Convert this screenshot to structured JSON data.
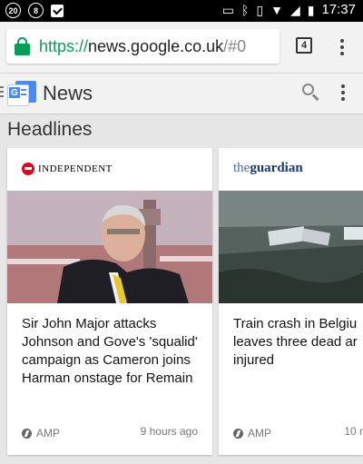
{
  "status_bar": {
    "left_icons": [
      "notification-20-icon",
      "notification-8-icon",
      "clipboard-check-icon"
    ],
    "badge_a": "20",
    "badge_b": "8",
    "right_icons": [
      "cast-icon",
      "bluetooth-icon",
      "vibrate-icon",
      "wifi-icon",
      "signal-icon",
      "battery-icon"
    ],
    "time": "17:37"
  },
  "browser": {
    "url_scheme": "https://",
    "url_host": "news.google.co.uk",
    "url_path": "/#0",
    "tab_count": "4",
    "secure_color": "#0b9d58"
  },
  "app_bar": {
    "title": "News"
  },
  "section": {
    "title": "Headlines"
  },
  "cards": [
    {
      "source": "INDEPENDENT",
      "headline": "Sir John Major attacks Johnson and Gove's 'squalid' campaign as Cameron joins Harman onstage for Remain",
      "amp_label": "AMP",
      "time": "9 hours ago"
    },
    {
      "source_prefix": "the",
      "source_name": "guardian",
      "headline_lines": [
        "Train crash in Belgiu",
        "leaves three dead ar",
        "injured"
      ],
      "amp_label": "AMP",
      "time": "10 m"
    }
  ]
}
